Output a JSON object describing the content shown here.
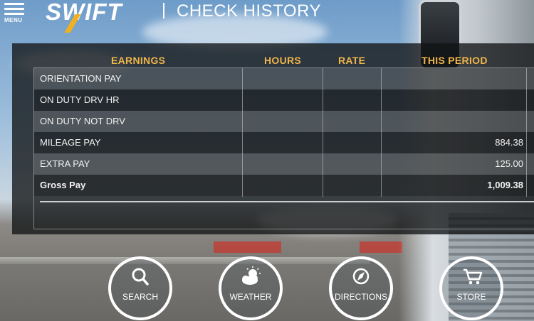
{
  "header": {
    "menu_label": "MENU",
    "logo_text": "SWIFT",
    "title": "CHECK HISTORY"
  },
  "table": {
    "headers": {
      "earnings": "EARNINGS",
      "hours": "HOURS",
      "rate": "RATE",
      "this_period": "THIS PERIOD"
    },
    "rows": [
      {
        "label": "ORIENTATION PAY",
        "hours": "",
        "rate": "",
        "amount": ""
      },
      {
        "label": "ON DUTY DRV HR",
        "hours": "",
        "rate": "",
        "amount": ""
      },
      {
        "label": "ON DUTY NOT DRV",
        "hours": "",
        "rate": "",
        "amount": ""
      },
      {
        "label": "MILEAGE PAY",
        "hours": "",
        "rate": "",
        "amount": "884.38"
      },
      {
        "label": "EXTRA PAY",
        "hours": "",
        "rate": "",
        "amount": "125.00"
      }
    ],
    "total": {
      "label": "Gross Pay",
      "amount": "1,009.38"
    }
  },
  "nav": [
    {
      "label": "SEARCH",
      "icon": "search-icon"
    },
    {
      "label": "WEATHER",
      "icon": "weather-icon"
    },
    {
      "label": "DIRECTIONS",
      "icon": "compass-icon"
    },
    {
      "label": "STORE",
      "icon": "cart-icon"
    }
  ],
  "colors": {
    "header_accent": "#f0b54a",
    "logo_accent": "#f2b01e"
  }
}
